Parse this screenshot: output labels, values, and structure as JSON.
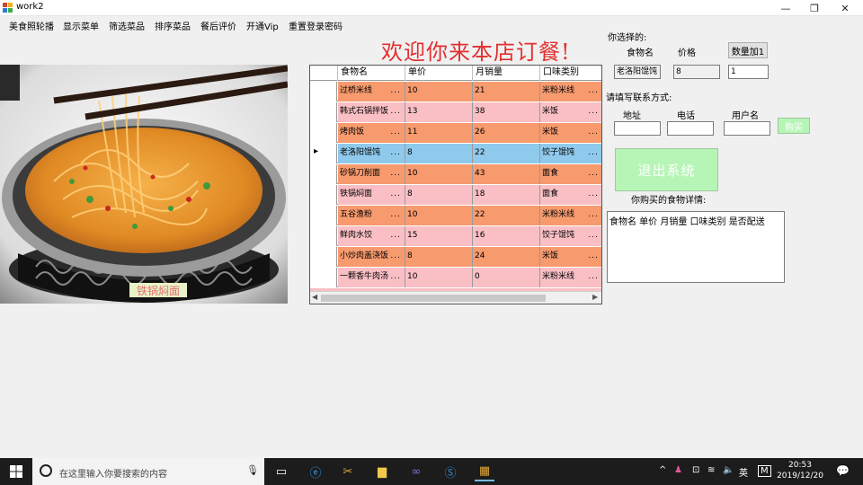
{
  "window": {
    "title": "work2",
    "controls": {
      "minimize": "—",
      "maximize": "❐",
      "close": "✕"
    }
  },
  "menu": [
    "美食照轮播",
    "显示菜单",
    "筛选菜品",
    "排序菜品",
    "餐后评价",
    "开通Vip",
    "重置登录密码"
  ],
  "welcome_text": "欢迎你来本店订餐!",
  "photo_caption": "铁锅焖面",
  "grid": {
    "columns": [
      "食物名",
      "单价",
      "月销量",
      "口味类别"
    ],
    "rows": [
      {
        "name": "过桥米线",
        "price": "10",
        "sales": "21",
        "category": "米粉米线",
        "color": "#f79a6e"
      },
      {
        "name": "韩式石锅拌饭",
        "price": "13",
        "sales": "38",
        "category": "米饭",
        "color": "#f9bfc5"
      },
      {
        "name": "烤肉饭",
        "price": "11",
        "sales": "26",
        "category": "米饭",
        "color": "#f79a6e"
      },
      {
        "name": "老洛阳馄饨",
        "price": "8",
        "sales": "22",
        "category": "饺子馄饨",
        "color": "#8fc9ec"
      },
      {
        "name": "砂锅刀削面",
        "price": "10",
        "sales": "43",
        "category": "面食",
        "color": "#f79a6e"
      },
      {
        "name": "铁锅焖面",
        "price": "8",
        "sales": "18",
        "category": "面食",
        "color": "#f9bfc5"
      },
      {
        "name": "五谷渔粉",
        "price": "10",
        "sales": "22",
        "category": "米粉米线",
        "color": "#f79a6e"
      },
      {
        "name": "鲜肉水饺",
        "price": "15",
        "sales": "16",
        "category": "饺子馄饨",
        "color": "#f9bfc5"
      },
      {
        "name": "小炒肉盖浇饭",
        "price": "8",
        "sales": "24",
        "category": "米饭",
        "color": "#f79a6e"
      },
      {
        "name": "一颗香牛肉汤",
        "price": "10",
        "sales": "0",
        "category": "米粉米线",
        "color": "#f9bfc5"
      }
    ],
    "selected_row_index": 3,
    "ellipsis": "..."
  },
  "selection": {
    "section_label": "你选择的:",
    "name_label": "食物名",
    "price_label": "价格",
    "qty_button": "数量加1",
    "name_value": "老洛阳馄饨",
    "price_value": "8",
    "qty_value": "1"
  },
  "contact": {
    "section_label": "请填写联系方式:",
    "address_label": "地址",
    "phone_label": "电话",
    "username_label": "用户名",
    "buy_button": "购买",
    "address_value": "",
    "phone_value": "",
    "username_value": ""
  },
  "exit_button": "退出系统",
  "details": {
    "label": "你购买的食物详情:",
    "header": "食物名 单价 月销量 口味类别 是否配送"
  },
  "taskbar": {
    "search_placeholder": "在这里输入你要搜索的内容",
    "ime": "英",
    "ime2": "M",
    "time": "20:53",
    "date": "2019/12/20"
  },
  "colors": {
    "row_orange": "#f79a6e",
    "row_pink": "#f9bfc5",
    "row_selected": "#8fc9ec",
    "welcome": "#e23030",
    "green_button": "#b7f5b7"
  }
}
